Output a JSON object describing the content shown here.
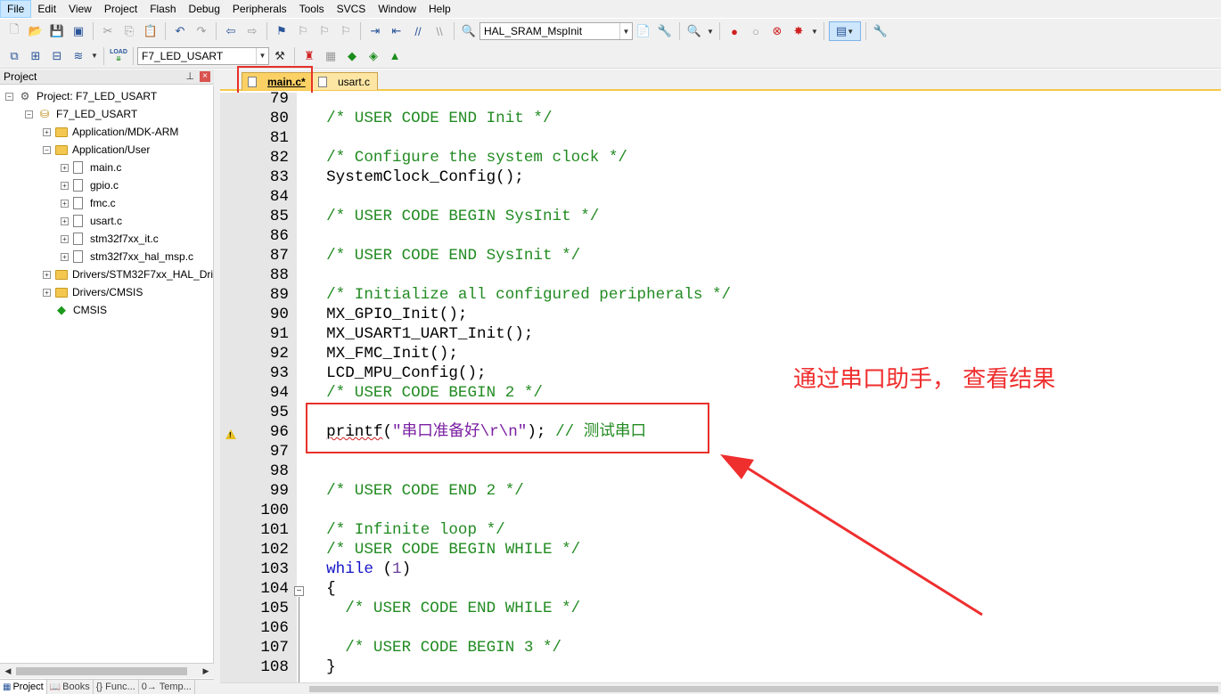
{
  "menu": [
    "File",
    "Edit",
    "View",
    "Project",
    "Flash",
    "Debug",
    "Peripherals",
    "Tools",
    "SVCS",
    "Window",
    "Help"
  ],
  "toolbar": {
    "function_combo": "HAL_SRAM_MspInit",
    "target_combo": "F7_LED_USART",
    "load_label": "LOAD"
  },
  "project_panel": {
    "title": "Project",
    "pin": "⊥",
    "close": "×",
    "tree": [
      {
        "label": "Project: F7_LED_USART",
        "level": 0,
        "kind": "project",
        "expander": "−"
      },
      {
        "label": "F7_LED_USART",
        "level": 1,
        "kind": "target",
        "expander": "−"
      },
      {
        "label": "Application/MDK-ARM",
        "level": 2,
        "kind": "folder",
        "expander": "+"
      },
      {
        "label": "Application/User",
        "level": 2,
        "kind": "folder",
        "expander": "−"
      },
      {
        "label": "main.c",
        "level": 3,
        "kind": "file",
        "expander": "+"
      },
      {
        "label": "gpio.c",
        "level": 3,
        "kind": "file",
        "expander": "+"
      },
      {
        "label": "fmc.c",
        "level": 3,
        "kind": "file",
        "expander": "+"
      },
      {
        "label": "usart.c",
        "level": 3,
        "kind": "file",
        "expander": "+"
      },
      {
        "label": "stm32f7xx_it.c",
        "level": 3,
        "kind": "file",
        "expander": "+"
      },
      {
        "label": "stm32f7xx_hal_msp.c",
        "level": 3,
        "kind": "file",
        "expander": "+"
      },
      {
        "label": "Drivers/STM32F7xx_HAL_Driv",
        "level": 2,
        "kind": "folder",
        "expander": "+"
      },
      {
        "label": "Drivers/CMSIS",
        "level": 2,
        "kind": "folder",
        "expander": "+"
      },
      {
        "label": "CMSIS",
        "level": 2,
        "kind": "cmsis",
        "expander": ""
      }
    ],
    "bottom_tabs": [
      "Project",
      "Books",
      "{} Func...",
      "0→ Temp..."
    ]
  },
  "editor": {
    "tabs": [
      {
        "label": "main.c*",
        "active": true
      },
      {
        "label": "usart.c",
        "active": false
      }
    ],
    "first_line": 79,
    "lines": [
      {
        "n": "79",
        "code": ""
      },
      {
        "n": "80",
        "code": "  /* USER CODE END Init */"
      },
      {
        "n": "81",
        "code": ""
      },
      {
        "n": "82",
        "code": "  /* Configure the system clock */"
      },
      {
        "n": "83",
        "code": "  SystemClock_Config();"
      },
      {
        "n": "84",
        "code": ""
      },
      {
        "n": "85",
        "code": "  /* USER CODE BEGIN SysInit */"
      },
      {
        "n": "86",
        "code": ""
      },
      {
        "n": "87",
        "code": "  /* USER CODE END SysInit */"
      },
      {
        "n": "88",
        "code": ""
      },
      {
        "n": "89",
        "code": "  /* Initialize all configured peripherals */"
      },
      {
        "n": "90",
        "code": "  MX_GPIO_Init();"
      },
      {
        "n": "91",
        "code": "  MX_USART1_UART_Init();"
      },
      {
        "n": "92",
        "code": "  MX_FMC_Init();"
      },
      {
        "n": "93",
        "code": "  LCD_MPU_Config();"
      },
      {
        "n": "94",
        "code": "  /* USER CODE BEGIN 2 */"
      },
      {
        "n": "95",
        "code": ""
      },
      {
        "n": "96",
        "code": "  printf(\"串口准备好\\r\\n\"); // 测试串口"
      },
      {
        "n": "97",
        "code": ""
      },
      {
        "n": "98",
        "code": ""
      },
      {
        "n": "99",
        "code": "  /* USER CODE END 2 */"
      },
      {
        "n": "100",
        "code": ""
      },
      {
        "n": "101",
        "code": "  /* Infinite loop */"
      },
      {
        "n": "102",
        "code": "  /* USER CODE BEGIN WHILE */"
      },
      {
        "n": "103",
        "code": "  while (1)"
      },
      {
        "n": "104",
        "code": "  {"
      },
      {
        "n": "105",
        "code": "    /* USER CODE END WHILE */"
      },
      {
        "n": "106",
        "code": ""
      },
      {
        "n": "107",
        "code": "    /* USER CODE BEGIN 3 */"
      },
      {
        "n": "108",
        "code": "  }"
      }
    ],
    "fold_marker": "−",
    "warning_line": "96"
  },
  "annotation": {
    "text": "通过串口助手， 查看结果",
    "color": "#ef2e2e"
  },
  "colors": {
    "comment": "#228b22",
    "keyword": "#1414c8",
    "string": "#7a1fa2",
    "tab_active": "#fbd165",
    "tab_inactive": "#fde6a4"
  }
}
